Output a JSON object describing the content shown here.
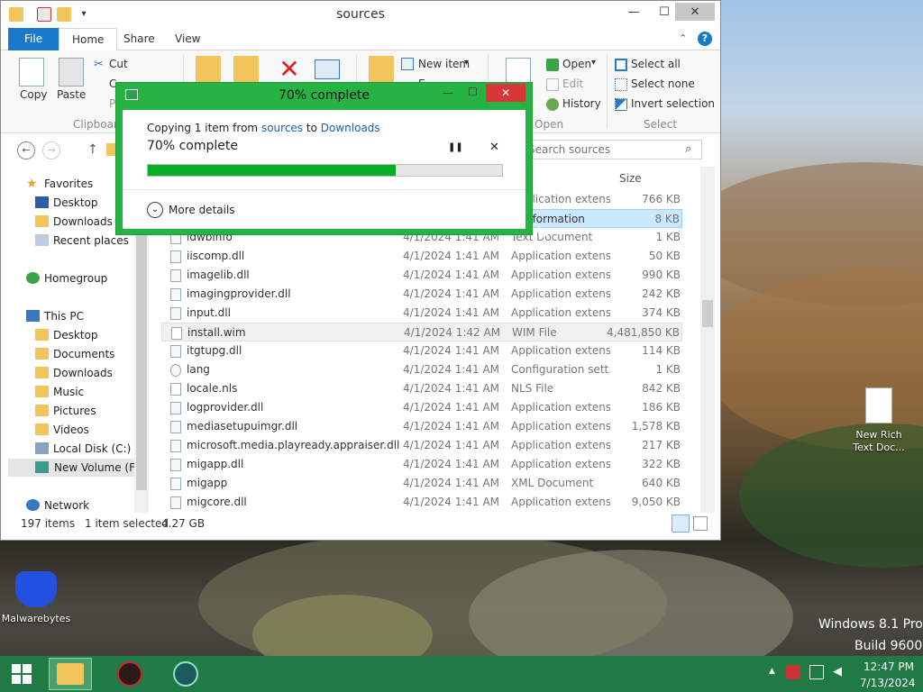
{
  "explorer": {
    "title": "sources",
    "min_glyph": "—",
    "max_glyph": "☐",
    "close_glyph": "✕",
    "tabs": {
      "file": "File",
      "home": "Home",
      "share": "Share",
      "view": "View"
    },
    "ribbon": {
      "copy": "Copy",
      "paste": "Paste",
      "cut": "Cut",
      "copy_path_partial": "C",
      "paste_shortcut_partial": "P",
      "clipboard_group": "Clipboar",
      "new_item": "New item",
      "new_item_arrow": "▾",
      "easy_access_partial": "E",
      "open": "Open",
      "open_arrow": "▾",
      "edit": "Edit",
      "history": "History",
      "open_group": "Open",
      "select_all": "Select all",
      "select_none": "Select none",
      "invert_selection": "Invert selection",
      "select_group": "Select"
    },
    "nav": {
      "back": "←",
      "forward": "→",
      "up": "↑",
      "search_placeholder": "Search sources"
    },
    "navpane": {
      "favorites": "Favorites",
      "fav_items": [
        "Desktop",
        "Downloads",
        "Recent places"
      ],
      "homegroup": "Homegroup",
      "this_pc": "This PC",
      "pc_items": [
        "Desktop",
        "Documents",
        "Downloads",
        "Music",
        "Pictures",
        "Videos",
        "Local Disk (C:)",
        "New Volume (F:)"
      ],
      "network": "Network"
    },
    "column_size": "Size",
    "files": [
      {
        "name": "",
        "date": "",
        "type": "Application extens...",
        "size": "766 KB"
      },
      {
        "name": "",
        "date": "",
        "type": "p Information",
        "size": "8 KB"
      },
      {
        "name": "idwbinfo",
        "date": "4/1/2024 1:41 AM",
        "type": "Text Document",
        "size": "1 KB"
      },
      {
        "name": "iiscomp.dll",
        "date": "4/1/2024 1:41 AM",
        "type": "Application extens...",
        "size": "50 KB"
      },
      {
        "name": "imagelib.dll",
        "date": "4/1/2024 1:41 AM",
        "type": "Application extens...",
        "size": "990 KB"
      },
      {
        "name": "imagingprovider.dll",
        "date": "4/1/2024 1:41 AM",
        "type": "Application extens...",
        "size": "242 KB"
      },
      {
        "name": "input.dll",
        "date": "4/1/2024 1:41 AM",
        "type": "Application extens...",
        "size": "374 KB"
      },
      {
        "name": "install.wim",
        "date": "4/1/2024 1:42 AM",
        "type": "WIM File",
        "size": "4,481,850 KB"
      },
      {
        "name": "itgtupg.dll",
        "date": "4/1/2024 1:41 AM",
        "type": "Application extens...",
        "size": "114 KB"
      },
      {
        "name": "lang",
        "date": "4/1/2024 1:41 AM",
        "type": "Configuration sett...",
        "size": "1 KB"
      },
      {
        "name": "locale.nls",
        "date": "4/1/2024 1:41 AM",
        "type": "NLS File",
        "size": "842 KB"
      },
      {
        "name": "logprovider.dll",
        "date": "4/1/2024 1:41 AM",
        "type": "Application extens...",
        "size": "186 KB"
      },
      {
        "name": "mediasetupuimgr.dll",
        "date": "4/1/2024 1:41 AM",
        "type": "Application extens...",
        "size": "1,578 KB"
      },
      {
        "name": "microsoft.media.playready.appraiser.dll",
        "date": "4/1/2024 1:41 AM",
        "type": "Application extens...",
        "size": "217 KB"
      },
      {
        "name": "migapp.dll",
        "date": "4/1/2024 1:41 AM",
        "type": "Application extens...",
        "size": "322 KB"
      },
      {
        "name": "migapp",
        "date": "4/1/2024 1:41 AM",
        "type": "XML Document",
        "size": "640 KB"
      },
      {
        "name": "migcore.dll",
        "date": "4/1/2024 1:41 AM",
        "type": "Application extens...",
        "size": "9,050 KB"
      }
    ],
    "status": {
      "items": "197 items",
      "selected": "1 item selected",
      "size": "4.27 GB"
    }
  },
  "copy_dialog": {
    "title": "70% complete",
    "prefix": "Copying 1 item from",
    "from": "sources",
    "to_word": "to",
    "to": "Downloads",
    "status": "70% complete",
    "progress": 0.7,
    "pause": "❚❚",
    "cancel": "✕",
    "more_details": "More details"
  },
  "desktop": {
    "rich_text_icon": "New Rich Text Doc...",
    "malwarebytes": "Malwarebytes",
    "watermark_line1": "Windows 8.1 Pro",
    "watermark_line2": "Build 9600"
  },
  "taskbar": {
    "time": "12:47 PM",
    "date": "7/13/2024"
  },
  "colors": {
    "accent_blue": "#1979ca",
    "dialog_green": "#27b344",
    "progress_green": "#06b025",
    "taskbar": "#1f7a45",
    "selection": "#cce8ff"
  },
  "icons": [
    "folder-icon",
    "search-icon",
    "shield-icon",
    "network-icon",
    "malwarebytes-icon",
    "windows-logo-icon"
  ]
}
